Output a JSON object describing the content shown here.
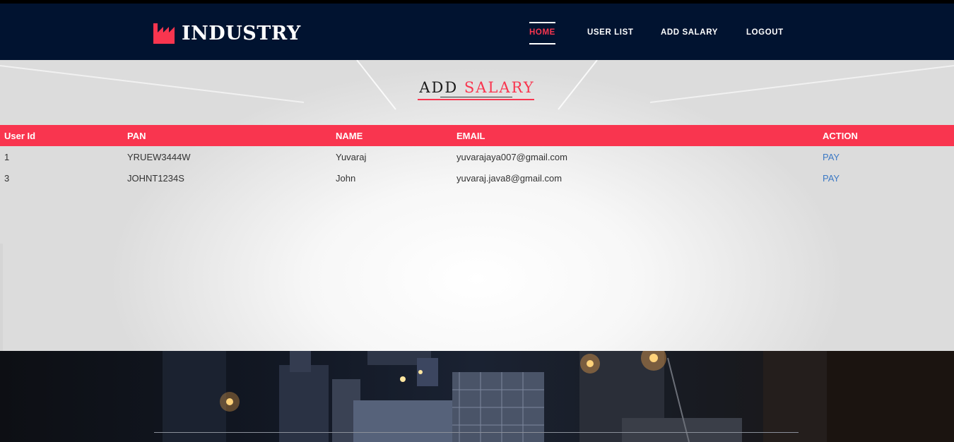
{
  "brand": {
    "name": "INDUSTRY",
    "icon": "factory-icon",
    "icon_color": "#f9354f"
  },
  "nav": {
    "items": [
      {
        "label": "HOME",
        "active": true
      },
      {
        "label": "USER LIST",
        "active": false
      },
      {
        "label": "ADD SALARY",
        "active": false
      },
      {
        "label": "LOGOUT",
        "active": false
      }
    ]
  },
  "section": {
    "title_part1": "ADD",
    "title_part2": "SALARY"
  },
  "table": {
    "headers": [
      "User Id",
      "PAN",
      "NAME",
      "EMAIL",
      "ACTION"
    ],
    "rows": [
      {
        "user_id": "1",
        "pan": "YRUEW3444W",
        "name": "Yuvaraj",
        "email": "yuvarajaya007@gmail.com",
        "action": "PAY"
      },
      {
        "user_id": "3",
        "pan": "JOHNT1234S",
        "name": "John",
        "email": "yuvaraj.java8@gmail.com",
        "action": "PAY"
      }
    ]
  },
  "colors": {
    "navbar_bg": "#011330",
    "accent": "#f9354f",
    "link": "#3c79c4"
  }
}
